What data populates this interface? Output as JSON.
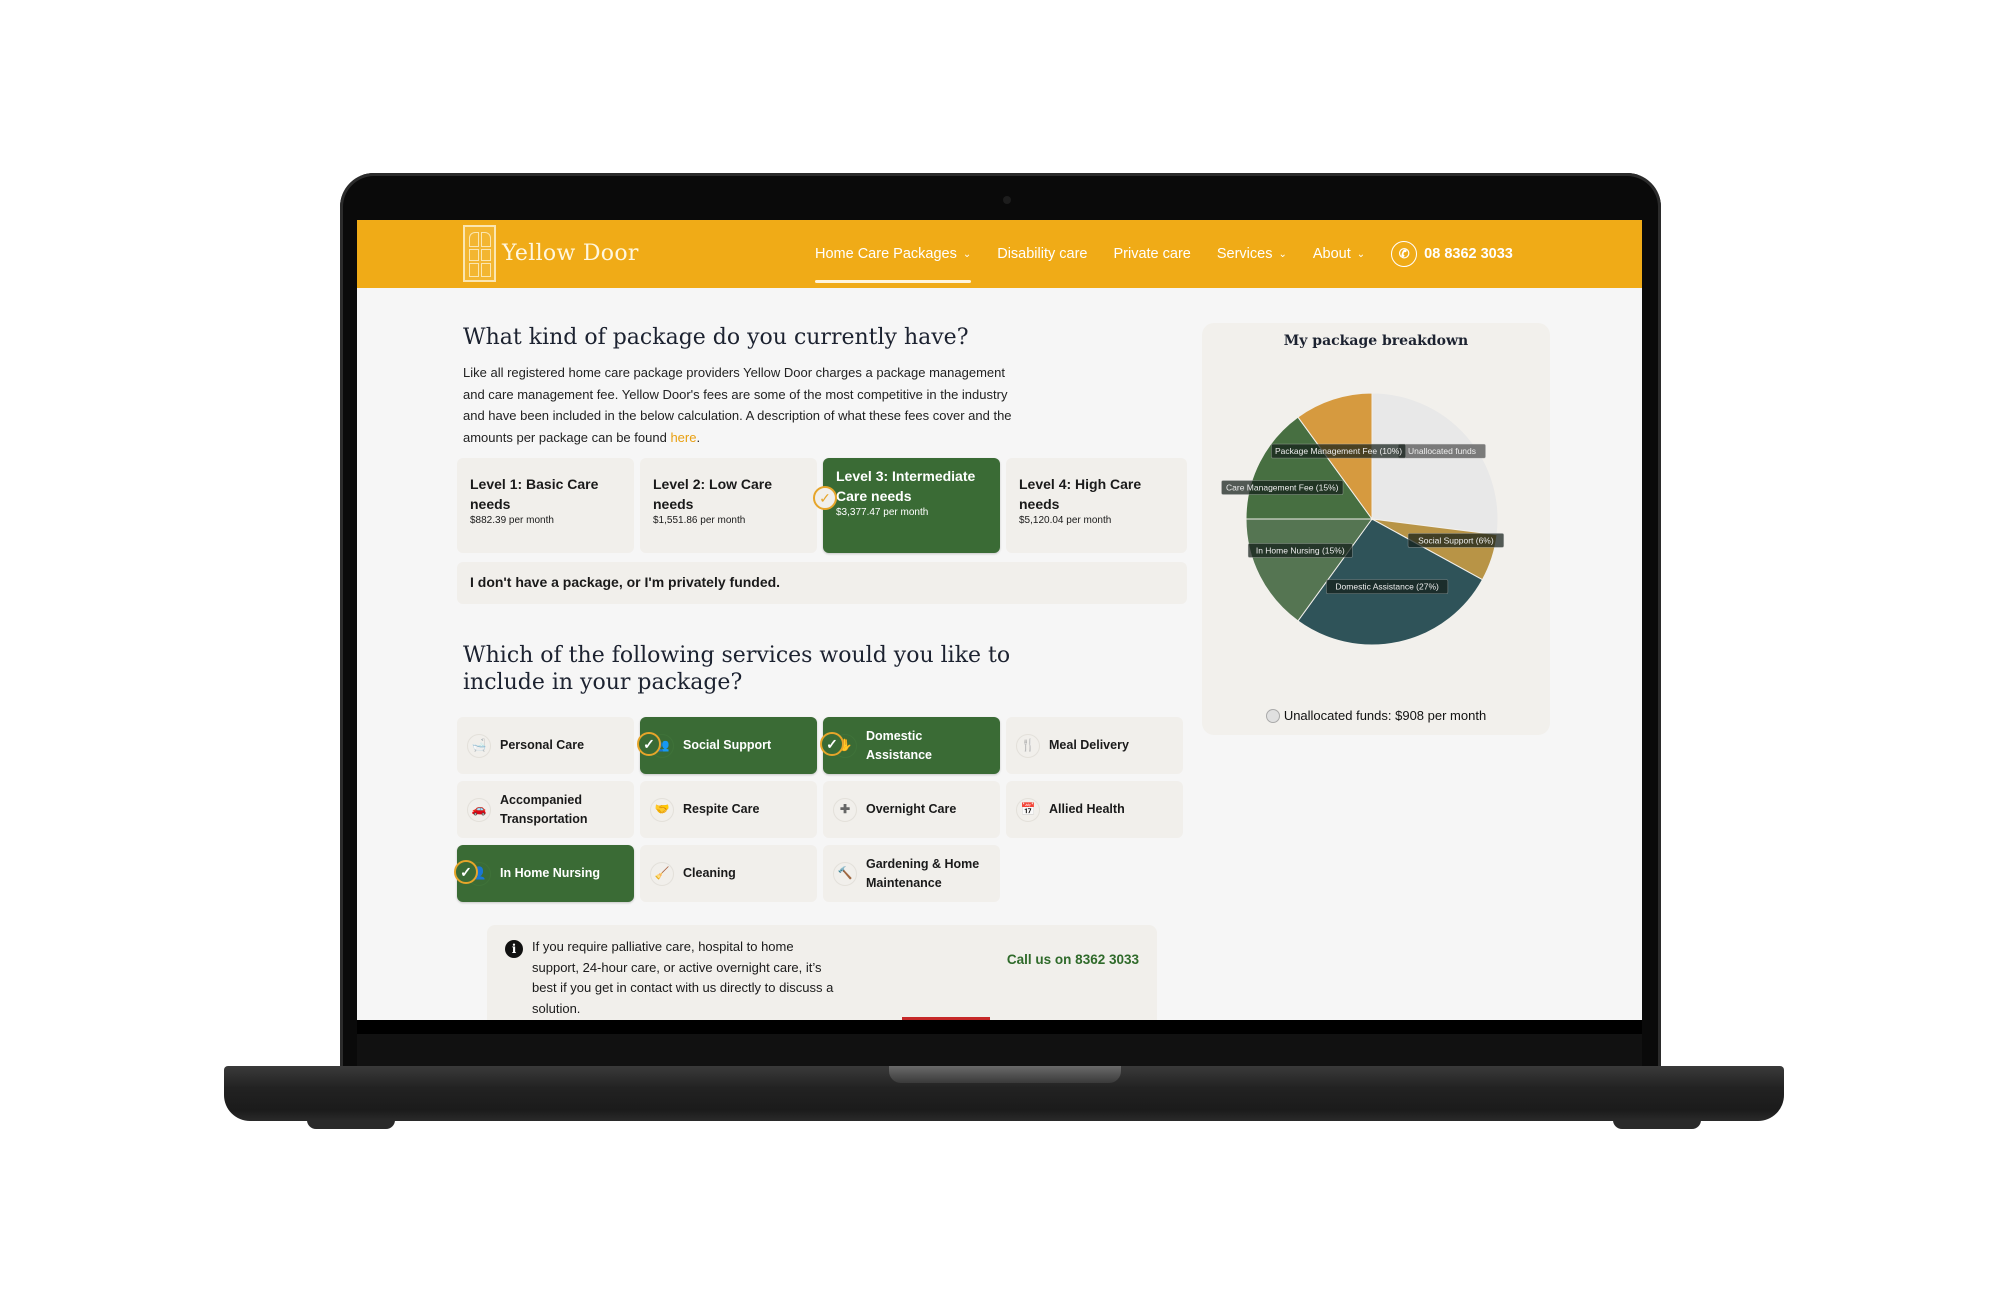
{
  "header": {
    "brand": "Yellow Door",
    "nav": [
      {
        "label": "Home Care Packages",
        "has_dropdown": true,
        "active": true
      },
      {
        "label": "Disability care",
        "has_dropdown": false,
        "active": false
      },
      {
        "label": "Private care",
        "has_dropdown": false,
        "active": false
      },
      {
        "label": "Services",
        "has_dropdown": true,
        "active": false
      },
      {
        "label": "About",
        "has_dropdown": true,
        "active": false
      }
    ],
    "phone": "08 8362 3033",
    "phone_icon": "phone-icon",
    "accent_color": "#f0ab17"
  },
  "package_section": {
    "title": "What kind of package do you currently have?",
    "intro": "Like all registered home care package providers Yellow Door charges a package management and care management fee. Yellow Door's fees are some of the most competitive in the industry and have been included in the below calculation. A description of what these fees cover and the amounts per package can be found ",
    "intro_link": "here",
    "intro_end": ".",
    "packages": [
      {
        "title": "Level 1: Basic Care needs",
        "price": "$882.39 per month",
        "selected": false
      },
      {
        "title": "Level 2: Low Care needs",
        "price": "$1,551.86 per month",
        "selected": false
      },
      {
        "title": "Level 3: Intermediate Care needs",
        "price": "$3,377.47 per month",
        "selected": true
      },
      {
        "title": "Level 4: High Care needs",
        "price": "$5,120.04 per month",
        "selected": false
      }
    ],
    "no_package": "I don't have a package, or I'm privately funded.",
    "selected_color": "#3a6b35"
  },
  "services_section": {
    "title": "Which of the following services would you like to include in your package?",
    "services": [
      {
        "label": "Personal Care",
        "icon": "bath-icon",
        "glyph": "🛁",
        "selected": false
      },
      {
        "label": "Social Support",
        "icon": "people-icon",
        "glyph": "👥",
        "selected": true
      },
      {
        "label": "Domestic Assistance",
        "icon": "hand-sparkle-icon",
        "glyph": "✋",
        "selected": true
      },
      {
        "label": "Meal Delivery",
        "icon": "utensils-icon",
        "glyph": "🍴",
        "selected": false
      },
      {
        "label": "Accompanied Transportation",
        "icon": "car-icon",
        "glyph": "🚗",
        "selected": false
      },
      {
        "label": "Respite Care",
        "icon": "handshake-icon",
        "glyph": "🤝",
        "selected": false
      },
      {
        "label": "Overnight Care",
        "icon": "hand-holding-medical-icon",
        "glyph": "✚",
        "selected": false
      },
      {
        "label": "Allied Health",
        "icon": "calendar-check-icon",
        "glyph": "📅",
        "selected": false
      },
      {
        "label": "In Home Nursing",
        "icon": "nurse-icon",
        "glyph": "👤",
        "selected": true
      },
      {
        "label": "Cleaning",
        "icon": "broom-icon",
        "glyph": "🧹",
        "selected": false
      },
      {
        "label": "Gardening & Home Maintenance",
        "icon": "hammer-icon",
        "glyph": "🔨",
        "selected": false
      }
    ]
  },
  "info_box": {
    "icon": "info-icon",
    "text": "If you require palliative care, hospital to home support, 24-hour care, or active overnight care, it’s best if you get in contact with us directly to discuss a solution.",
    "call_label": "Call us on 8362 3033"
  },
  "breakdown": {
    "title": "My package breakdown",
    "legend": "Unallocated funds: $908 per month"
  },
  "chart_data": {
    "type": "pie",
    "title": "My package breakdown",
    "start": "top",
    "direction": "clockwise",
    "series": [
      {
        "name": "Unallocated funds",
        "label": "Unallocated funds",
        "value": 27,
        "color": "#e8e8e8"
      },
      {
        "name": "Social Support",
        "label": "Social Support (6%)",
        "value": 6,
        "color": "#b89446"
      },
      {
        "name": "Domestic Assistance",
        "label": "Domestic Assistance (27%)",
        "value": 27,
        "color": "#2f5359"
      },
      {
        "name": "In Home Nursing",
        "label": "In Home Nursing (15%)",
        "value": 15,
        "color": "#557552"
      },
      {
        "name": "Care Management Fee",
        "label": "Care Management Fee (15%)",
        "value": 15,
        "color": "#476f41"
      },
      {
        "name": "Package Management Fee",
        "label": "Package Management Fee (10%)",
        "value": 10,
        "color": "#d69a3f"
      }
    ],
    "legend": "Unallocated funds: $908 per month"
  }
}
